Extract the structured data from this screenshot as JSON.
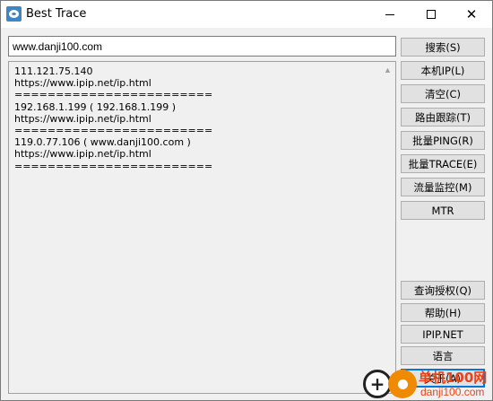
{
  "window": {
    "title": "Best Trace",
    "controls": {
      "minimize": "",
      "maximize": "",
      "close": "✕"
    }
  },
  "address": {
    "value": "www.danji100.com"
  },
  "output": {
    "lines": [
      "111.121.75.140",
      "https://www.ipip.net/ip.html",
      "========================",
      "192.168.1.199 ( 192.168.1.199 )",
      "https://www.ipip.net/ip.html",
      "========================",
      "119.0.77.106 ( www.danji100.com )",
      "https://www.ipip.net/ip.html",
      "========================"
    ],
    "scroll_up_icon": "▲",
    "scroll_down_icon": "▼"
  },
  "buttons": {
    "search": "搜索(S)",
    "local_ip": "本机IP(L)",
    "clear": "清空(C)",
    "route_trace": "路由跟踪(T)",
    "batch_ping": "批量PING(R)",
    "batch_trace": "批量TRACE(E)",
    "traffic_monitor": "流量监控(M)",
    "mtr": "MTR",
    "query_license": "查询授权(Q)",
    "help": "帮助(H)",
    "ipip_net": "IPIP.NET",
    "language": "语言",
    "about": "关于(A)"
  },
  "watermark": {
    "line1": "单机100网",
    "line2": "danji100.com",
    "plus_icon": "+"
  }
}
